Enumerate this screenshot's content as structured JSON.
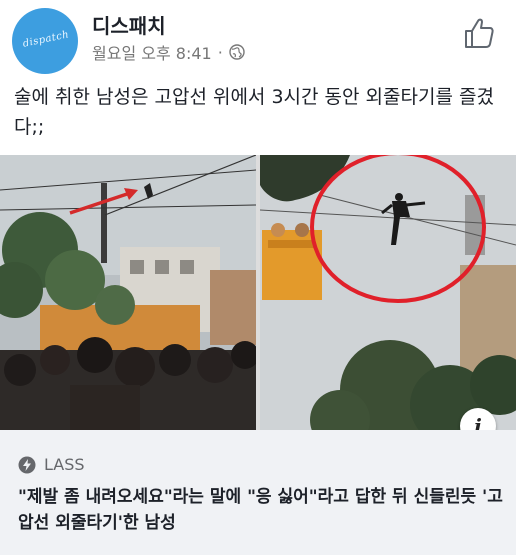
{
  "header": {
    "page_name": "디스패치",
    "timestamp": "월요일 오후 8:41",
    "avatar_text": "dispatch",
    "privacy_icon": "globe-icon",
    "like_icon": "thumbs-up-icon"
  },
  "post": {
    "text": "술에 취한 남성은 고압선 위에서 3시간 동안 외줄타기를 즐겼다;;"
  },
  "media": {
    "info_icon_label": "i"
  },
  "link": {
    "source": "LASS",
    "source_icon": "lightning-bolt-icon",
    "title": "\"제발 좀 내려오세요\"라는 말에 \"응 싫어\"라고 답한 뒤 신들린듯 '고압선 외줄타기'한 남성"
  },
  "colors": {
    "avatar_bg": "#3d9ee0",
    "link_box_bg": "#f0f2f5",
    "highlight_circle": "#e0202a",
    "arrow": "#d42a2a"
  }
}
